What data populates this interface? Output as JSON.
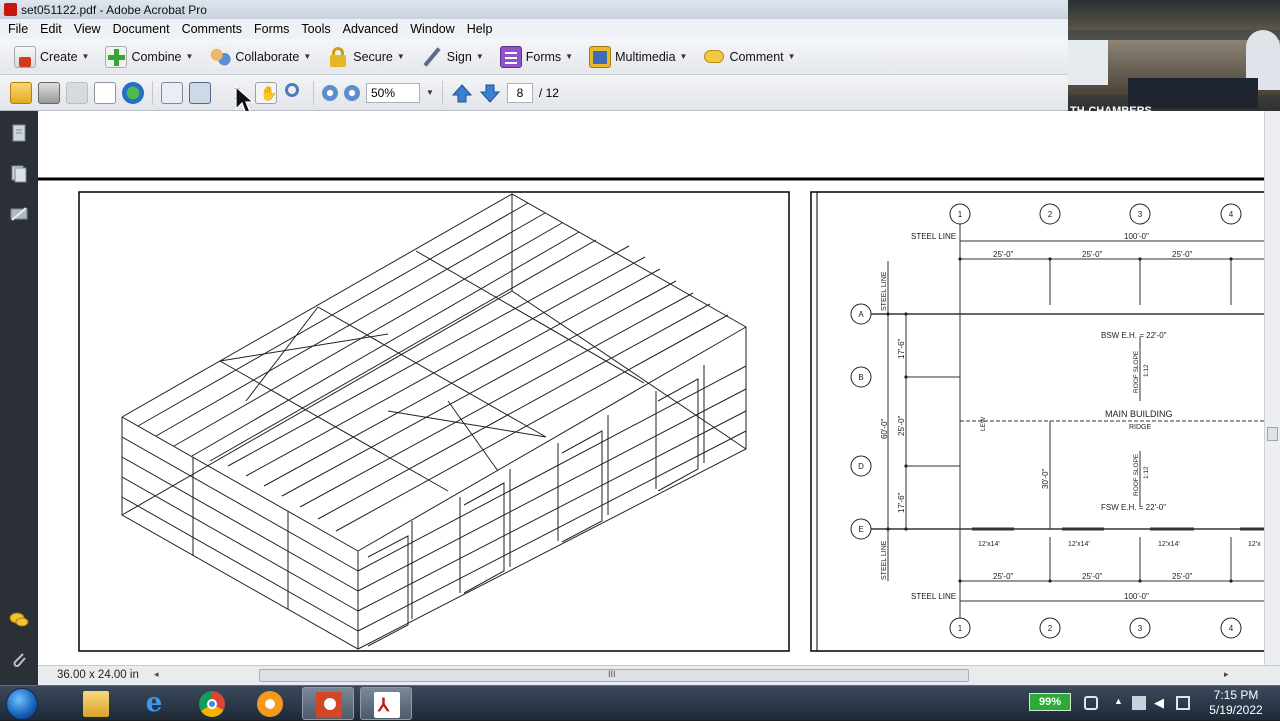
{
  "window": {
    "title": "set051122.pdf - Adobe Acrobat Pro"
  },
  "menu": [
    "File",
    "Edit",
    "View",
    "Document",
    "Comments",
    "Forms",
    "Tools",
    "Advanced",
    "Window",
    "Help"
  ],
  "toolbar": {
    "tasks": [
      {
        "label": "Create",
        "icon": "create-icon"
      },
      {
        "label": "Combine",
        "icon": "combine-icon"
      },
      {
        "label": "Collaborate",
        "icon": "collaborate-icon"
      },
      {
        "label": "Secure",
        "icon": "lock-icon"
      },
      {
        "label": "Sign",
        "icon": "pen-icon"
      },
      {
        "label": "Forms",
        "icon": "form-icon"
      },
      {
        "label": "Multimedia",
        "icon": "multimedia-icon"
      },
      {
        "label": "Comment",
        "icon": "comment-icon"
      }
    ],
    "zoom": "50%",
    "page_current": "8",
    "page_total": "/ 12"
  },
  "webcam": {
    "label": "TH-CHAMBERS"
  },
  "drawing": {
    "column_labels": [
      "1",
      "2",
      "3",
      "4"
    ],
    "row_labels": [
      "A",
      "B",
      "D",
      "E"
    ],
    "steel_line": "STEEL LINE",
    "overall_width": "100'-0\"",
    "bay_spacing": "25'-0\"",
    "end_spacing_a": "17'-6\"",
    "end_spacing_b": "25'-0\"",
    "overall_depth": "60'-0\"",
    "inner_dim": "30'-0\"",
    "bsw_note": "BSW E.H. = 22'-0\"",
    "fsw_note": "FSW E.H. = 22'-0\"",
    "roof_slope": "ROOF SLOPE",
    "slope_value": "1:12",
    "main_building": "MAIN BUILDING",
    "ridge": "RIDGE",
    "lew": "LEW",
    "door_size": "12'x14'",
    "door_size_partial": "12'x"
  },
  "status": {
    "page_size": "36.00 x 24.00 in",
    "scroll_grip": "III"
  },
  "taskbar": {
    "battery": "99%",
    "time": "7:15 PM",
    "date": "5/19/2022"
  },
  "colors": {
    "titlebar": "#d3dbe5",
    "acrobat_red": "#c8160f",
    "taskbar": "#2a3646",
    "battery_green": "#2faa3a"
  }
}
